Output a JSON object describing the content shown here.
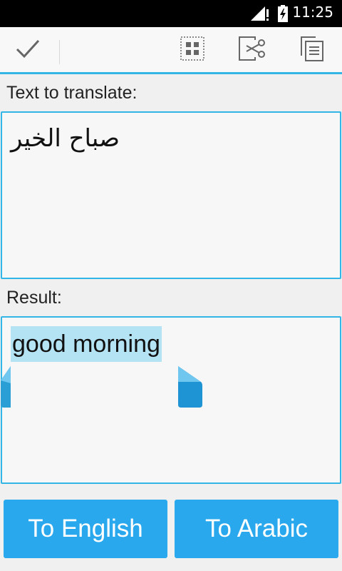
{
  "status_bar": {
    "time": "11:25",
    "icons": [
      "signal-alert-icon",
      "battery-charging-icon"
    ]
  },
  "action_bar": {
    "actions": [
      {
        "name": "done",
        "icon": "checkmark-icon"
      },
      {
        "name": "select-all",
        "icon": "select-all-icon"
      },
      {
        "name": "cut",
        "icon": "scissors-icon"
      },
      {
        "name": "copy",
        "icon": "copy-icon"
      }
    ],
    "accent_color": "#33b5e5"
  },
  "source": {
    "label": "Text to translate:",
    "text": "صباح الخير"
  },
  "result": {
    "label": "Result:",
    "text": "good morning",
    "selection_color": "#b4e3f4"
  },
  "buttons": {
    "to_english": "To English",
    "to_arabic": "To Arabic",
    "color": "#29a8ee"
  }
}
